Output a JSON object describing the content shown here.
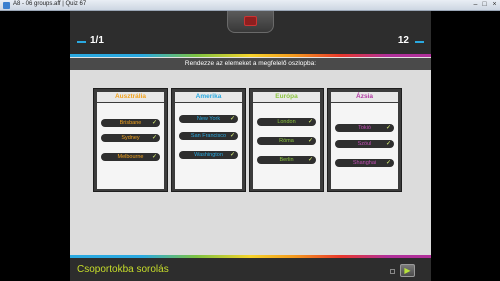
{
  "window": {
    "title": "A8 - 06 groups.aff  |  Quiz 67"
  },
  "quiz": {
    "counter_left": "1/1",
    "counter_right": "12",
    "instruction": "Rendezze az elemeket a megfelelő oszlopba:",
    "footer_label": "Csoportokba sorolás",
    "check_mark": "✓",
    "next_glyph": "▶"
  },
  "columns": [
    {
      "header": "Ausztrália",
      "color": "#f2a21d",
      "items": [
        "Brisbane",
        "Sydney",
        "Melbourne"
      ]
    },
    {
      "header": "Amerika",
      "color": "#2aa9e0",
      "items": [
        "New York",
        "San Francisco",
        "Washington"
      ]
    },
    {
      "header": "Európa",
      "color": "#8cc63f",
      "items": [
        "London",
        "Róma",
        "Berlin"
      ]
    },
    {
      "header": "Ázsia",
      "color": "#b13aa3",
      "items": [
        "Tokió",
        "Szöul",
        "Shanghai"
      ]
    }
  ]
}
